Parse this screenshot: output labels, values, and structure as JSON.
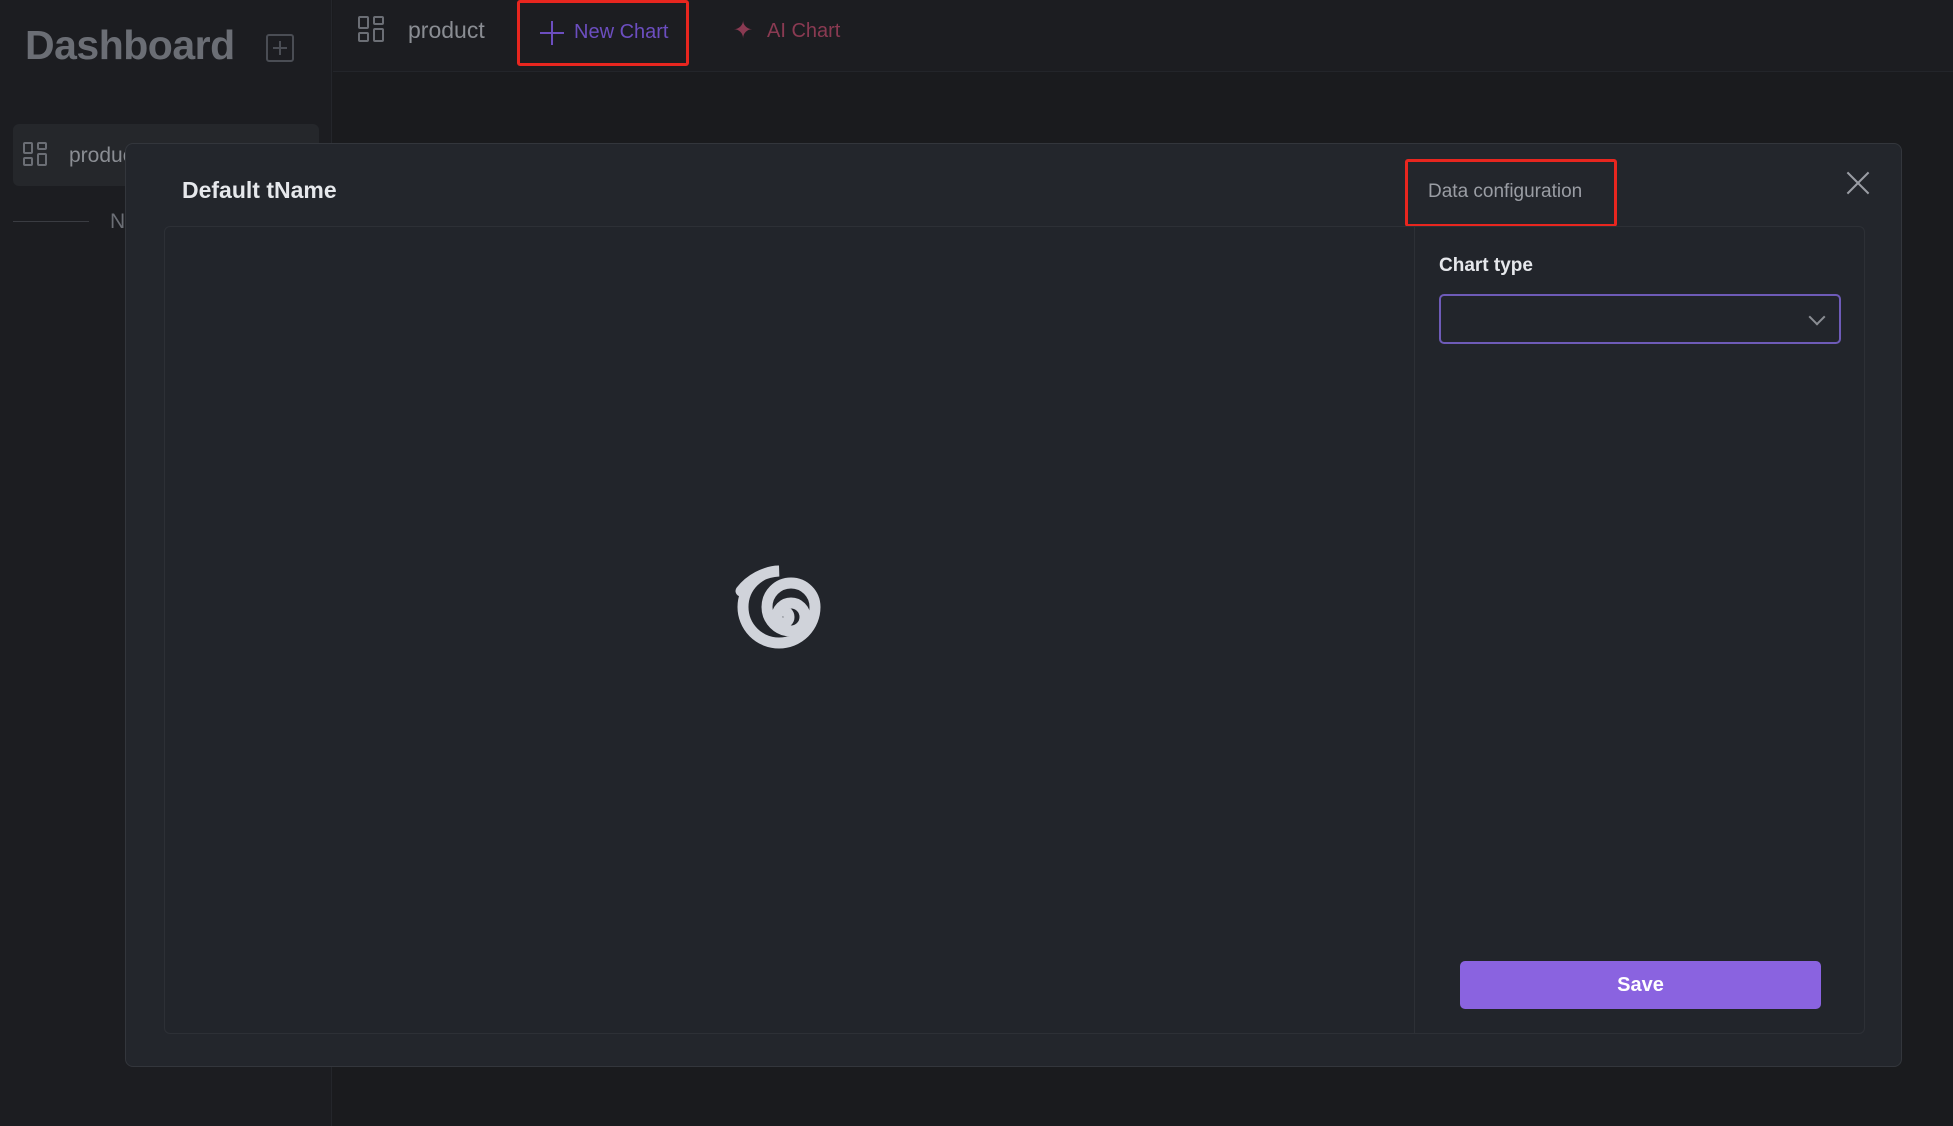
{
  "sidebar": {
    "brand": "Dashboard",
    "add_icon": "plus-square-icon",
    "items": [
      {
        "label": "product",
        "icon": "grid-icon"
      }
    ],
    "new_text": "N"
  },
  "topbar": {
    "tabs": [
      {
        "label": "product",
        "icon": "grid-icon"
      }
    ],
    "new_chart": {
      "label": "New Chart",
      "icon": "plus-icon"
    },
    "ai_chart": {
      "label": "AI Chart",
      "icon": "sparkle-icon"
    }
  },
  "modal": {
    "title": "Default tName",
    "config_tab": "Data configuration",
    "close_icon": "close-icon",
    "loading_icon": "spiral-loading-icon",
    "panel": {
      "chart_type_label": "Chart type",
      "chart_type_value": "",
      "save_label": "Save"
    }
  },
  "colors": {
    "accent": "#8a63e0",
    "highlight": "#e8261f",
    "new_chart_text": "#6c4ec0",
    "ai_chart_text": "#8a3a52"
  }
}
